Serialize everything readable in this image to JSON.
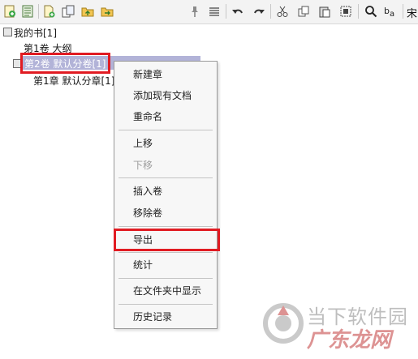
{
  "toolbar": {
    "buttons": [
      {
        "icon": "new-document-icon"
      },
      {
        "icon": "outline-icon"
      },
      {
        "icon": "add-file-icon"
      },
      {
        "icon": "copy-document-icon"
      },
      {
        "icon": "folder-up-icon"
      },
      {
        "icon": "folder-export-icon"
      },
      {
        "icon": "pin-icon"
      },
      {
        "icon": "align-icon"
      },
      {
        "icon": "undo-icon"
      },
      {
        "icon": "redo-icon"
      },
      {
        "icon": "cut-icon"
      },
      {
        "icon": "copy-icon"
      },
      {
        "icon": "paste-icon"
      },
      {
        "icon": "select-all-icon"
      },
      {
        "icon": "search-icon"
      },
      {
        "icon": "replace-icon"
      }
    ],
    "font_text": "宋"
  },
  "tree": {
    "book": "我的书[1]",
    "volume1": "第1卷 大纲",
    "volume2": "第2卷 默认分卷[1]",
    "chapter1": "第1章 默认分章[1]"
  },
  "context_menu": {
    "items": [
      {
        "label": "新建章",
        "enabled": true
      },
      {
        "label": "添加现有文档",
        "enabled": true
      },
      {
        "label": "重命名",
        "enabled": true
      },
      {
        "label": "上移",
        "enabled": true
      },
      {
        "label": "下移",
        "enabled": false
      },
      {
        "label": "插入卷",
        "enabled": true
      },
      {
        "label": "移除卷",
        "enabled": true
      },
      {
        "label": "导出",
        "enabled": true
      },
      {
        "label": "统计",
        "enabled": true
      },
      {
        "label": "在文件夹中显示",
        "enabled": true
      },
      {
        "label": "历史记录",
        "enabled": true
      }
    ]
  },
  "watermark": {
    "line1": "当下软件园",
    "line2": "广东龙网"
  },
  "colors": {
    "selection": "#b2b3d8",
    "highlight": "#e11b22"
  }
}
